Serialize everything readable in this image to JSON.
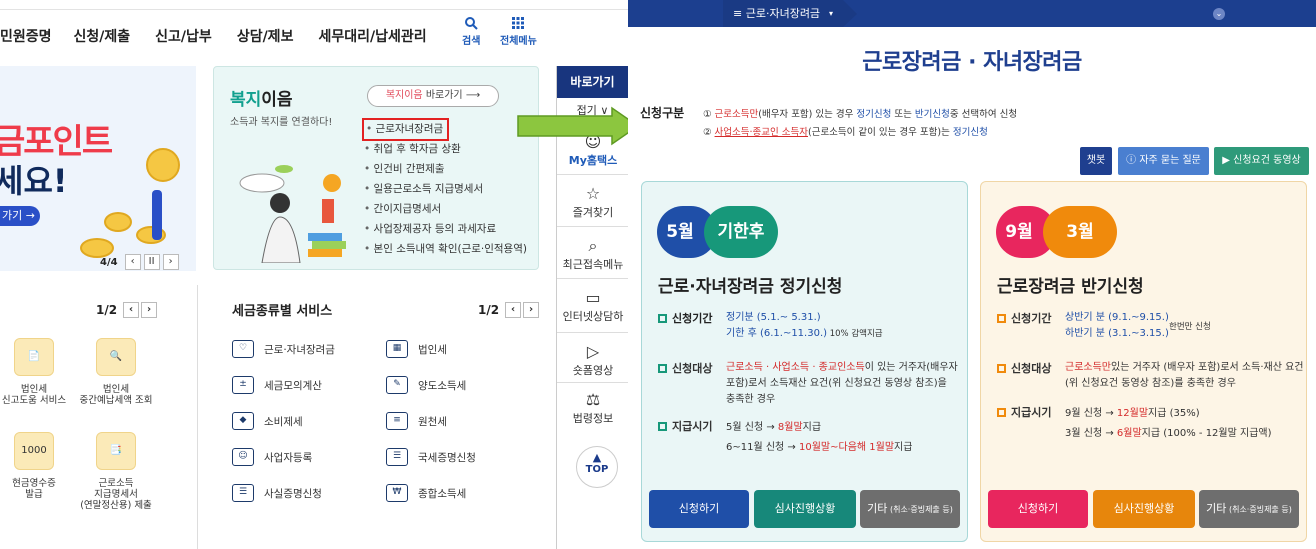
{
  "left": {
    "gnb": [
      "민원증명",
      "신청/제출",
      "신고/납부",
      "상담/제보",
      "세무대리/납세관리"
    ],
    "search_label": "검색",
    "menu_label": "전체메뉴",
    "banner": {
      "line1": "금포인트",
      "line2": "세요!",
      "button": "가기 →",
      "page": "4/4"
    },
    "welfare": {
      "title_a": "복지",
      "title_b": "이음",
      "subtitle": "소득과 복지를 연결하다!",
      "go_a": "복지이음",
      "go_b": " 바로가기",
      "items": [
        "근로자녀장려금",
        "취업 후 학자금 상환",
        "인건비 간편제출",
        "일용근로소득 지급명세서",
        "간이지급명세서",
        "사업장제공자 등의 과세자료",
        "본인 소득내역 확인(근로·인적용역)"
      ]
    },
    "left_pager": "1/2",
    "left_services": [
      "법인세\n신고도움 서비스",
      "법인세\n중간예납세액 조회",
      "현금영수증\n발급",
      "근로소득\n지급명세서\n(연말정산용) 제출"
    ],
    "svc_head": "세금종류별 서비스",
    "svc_pager": "1/2",
    "services": [
      "근로·자녀장려금",
      "법인세",
      "세금모의계산",
      "양도소득세",
      "소비제세",
      "원천세",
      "사업자등록",
      "국세증명신청",
      "사실증명신청",
      "종합소득세"
    ],
    "quick": {
      "title": "바로가기",
      "fold": "접기 ∨",
      "items": [
        "My홈택스",
        "즐겨찾기",
        "최근접속메뉴",
        "인터넷상담하",
        "숏폼영상",
        "법령정보"
      ],
      "top": "TOP"
    }
  },
  "right": {
    "tab": "근로·자녀장려금",
    "title": "근로장려금 · 자녀장려금",
    "gubun": "신청구분",
    "line1": {
      "a": "① ",
      "b": "근로소득만",
      "c": "(배우자 포함) 있는 경우 ",
      "d": "정기신청",
      "e": " 또는 ",
      "f": "반기신청",
      "g": "중 선택하여 신청"
    },
    "line2": {
      "a": "② ",
      "b": "사업소득·종교인 소득자",
      "c": "(근로소득이 같이 있는 경우 포함)는 ",
      "d": "정기신청"
    },
    "buttons": {
      "chat": "챗봇",
      "faq": "자주 묻는 질문",
      "video": "신청요건 동영상"
    },
    "card1": {
      "pill_a": "5월",
      "pill_b": "기한후",
      "title": "근로·자녀장려금 정기신청",
      "period_k": "신청기간",
      "period_1": "정기분 (5.1.~ 5.31.)",
      "period_2": "기한 후 (6.1.~11.30.)",
      "period_2b": " 10% 감액지급",
      "target_k": "신청대상",
      "target_a": "근로소득 · 사업소득 · 종교인소득",
      "target_b": "이 있는 거주자(배우자",
      "target_c": "포함)로서 소득재산 요건(위 신청요건 동영상 참조)을",
      "target_d": "충족한 경우",
      "pay_k": "지급시기",
      "pay_1a": "5월 신청 → ",
      "pay_1b": "8월말",
      "pay_1c": "지급",
      "pay_2a": "6~11월 신청 → ",
      "pay_2b": "10월말~다음해 1월말",
      "pay_2c": "지급",
      "btn1": "신청하기",
      "btn2": "심사진행상황",
      "btn3": "기타",
      "btn3s": " (취소·증빙제출 등)"
    },
    "card2": {
      "pill_a": "9월",
      "pill_b": "3월",
      "title": "근로장려금 반기신청",
      "period_k": "신청기간",
      "period_1": "상반기 분 (9.1.~9.15.)",
      "period_2": "하반기 분 (3.1.~3.15.)",
      "period_note": "한번만 신청",
      "target_k": "신청대상",
      "target_a": "근로소득만",
      "target_b": "있는 거주자 (배우자 포함)로서 소득·재산 요건",
      "target_c": "(위 신청요건 동영상 참조)를 충족한 경우",
      "pay_k": "지급시기",
      "pay_1a": "9월 신청 → ",
      "pay_1b": "12월말",
      "pay_1c": "지급 (35%)",
      "pay_2a": "3월 신청 → ",
      "pay_2b": "6월말",
      "pay_2c": "지급 (100% - 12월말 지급액)",
      "btn1": "신청하기",
      "btn2": "심사진행상황",
      "btn3": "기타",
      "btn3s": " (취소·증빙제출 등)"
    },
    "colors": {
      "navy": "#1c3f8f",
      "teal": "#11a08f",
      "red": "#d42a2a",
      "blue": "#1f4fa8",
      "pink": "#e8265e",
      "orange": "#f08a0c"
    }
  }
}
